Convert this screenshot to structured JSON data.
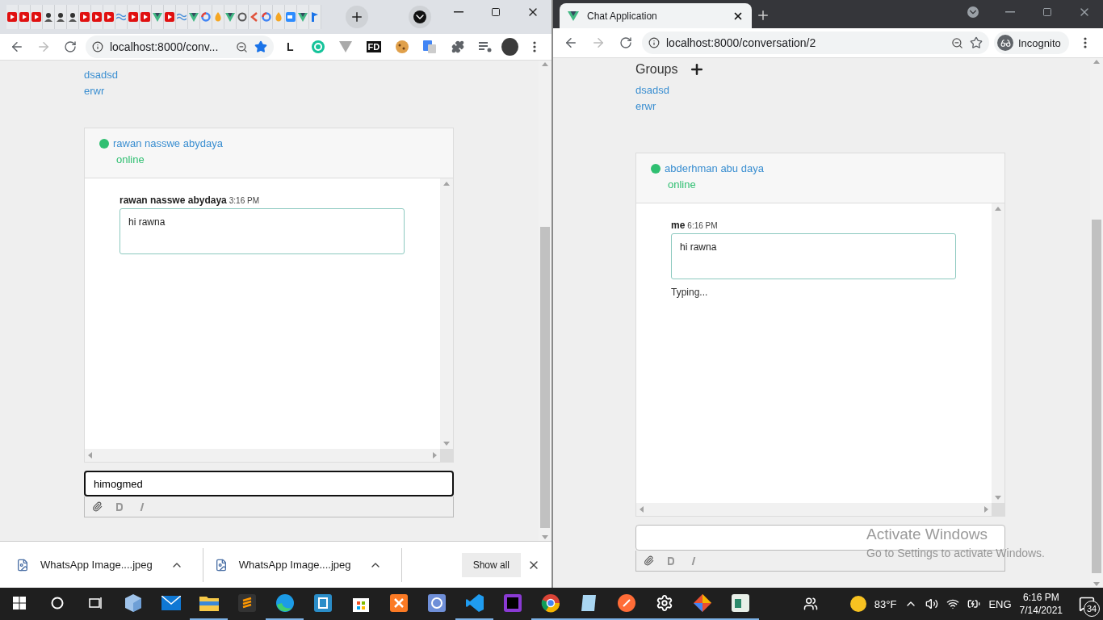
{
  "left_window": {
    "tabs": [
      {
        "kind": "play"
      },
      {
        "kind": "play"
      },
      {
        "kind": "play"
      },
      {
        "kind": "person"
      },
      {
        "kind": "person"
      },
      {
        "kind": "person"
      },
      {
        "kind": "play"
      },
      {
        "kind": "play"
      },
      {
        "kind": "play"
      },
      {
        "kind": "wave"
      },
      {
        "kind": "play"
      },
      {
        "kind": "play"
      },
      {
        "kind": "vee"
      },
      {
        "kind": "play"
      },
      {
        "kind": "wave"
      },
      {
        "kind": "vee"
      },
      {
        "kind": "ring"
      },
      {
        "kind": "flame"
      },
      {
        "kind": "vee"
      },
      {
        "kind": "cycle"
      },
      {
        "kind": "brace"
      },
      {
        "kind": "ring"
      },
      {
        "kind": "flame"
      },
      {
        "kind": "camera"
      },
      {
        "kind": "vee"
      },
      {
        "kind": "flag"
      }
    ],
    "address": "localhost:8000/conv...",
    "bookmarked": true,
    "extensions": [
      {
        "kind": "letter",
        "label": "L"
      },
      {
        "kind": "grammarly"
      },
      {
        "kind": "vee"
      },
      {
        "kind": "badge",
        "label": "FD"
      },
      {
        "kind": "cookie"
      },
      {
        "kind": "translate"
      },
      {
        "kind": "puzzle"
      },
      {
        "kind": "media"
      }
    ],
    "page": {
      "groups": [
        "dsadsd",
        "erwr"
      ],
      "contact": {
        "name": "rawan nasswe abydaya",
        "status": "online"
      },
      "messages": [
        {
          "author": "rawan nasswe abydaya",
          "time": "3:16 PM",
          "text": "hi rawna"
        }
      ],
      "composer": {
        "value": "himogmed",
        "focused": true
      }
    },
    "downloads": [
      {
        "name": "WhatsApp Image....jpeg"
      },
      {
        "name": "WhatsApp Image....jpeg"
      }
    ],
    "show_all": "Show all"
  },
  "right_window": {
    "tab_title": "Chat Application",
    "address": "localhost:8000/conversation/2",
    "bookmarked": false,
    "incognito": "Incognito",
    "page": {
      "groups_title": "Groups",
      "groups": [
        "dsadsd",
        "erwr"
      ],
      "contact": {
        "name": "abderhman abu daya",
        "status": "online"
      },
      "messages": [
        {
          "author": "me",
          "time": "6:16 PM",
          "text": "hi rawna"
        }
      ],
      "typing": "Typing...",
      "composer": {
        "focused": false
      }
    }
  },
  "activation": {
    "title": "Activate Windows",
    "hint": "Go to Settings to activate Windows."
  },
  "taskbar": {
    "apps": [
      {
        "kind": "cube",
        "running": false
      },
      {
        "kind": "mail",
        "running": false
      },
      {
        "kind": "folder",
        "running": true
      },
      {
        "kind": "sublime",
        "running": false
      },
      {
        "kind": "edge",
        "running": true
      },
      {
        "kind": "bracket",
        "running": false
      },
      {
        "kind": "store",
        "running": false
      },
      {
        "kind": "xampp",
        "running": false
      },
      {
        "kind": "jc",
        "running": false
      },
      {
        "kind": "vscode",
        "running": true
      },
      {
        "kind": "phpstorm",
        "running": false
      },
      {
        "kind": "chrome",
        "running": true
      },
      {
        "kind": "notepad",
        "running": true
      },
      {
        "kind": "postman",
        "running": true
      },
      {
        "kind": "settings",
        "running": true
      },
      {
        "kind": "git",
        "running": true
      },
      {
        "kind": "window",
        "running": true
      }
    ],
    "temperature": "83°F",
    "language": "ENG",
    "time": "6:16 PM",
    "date": "7/14/2021",
    "notifications": "34"
  }
}
